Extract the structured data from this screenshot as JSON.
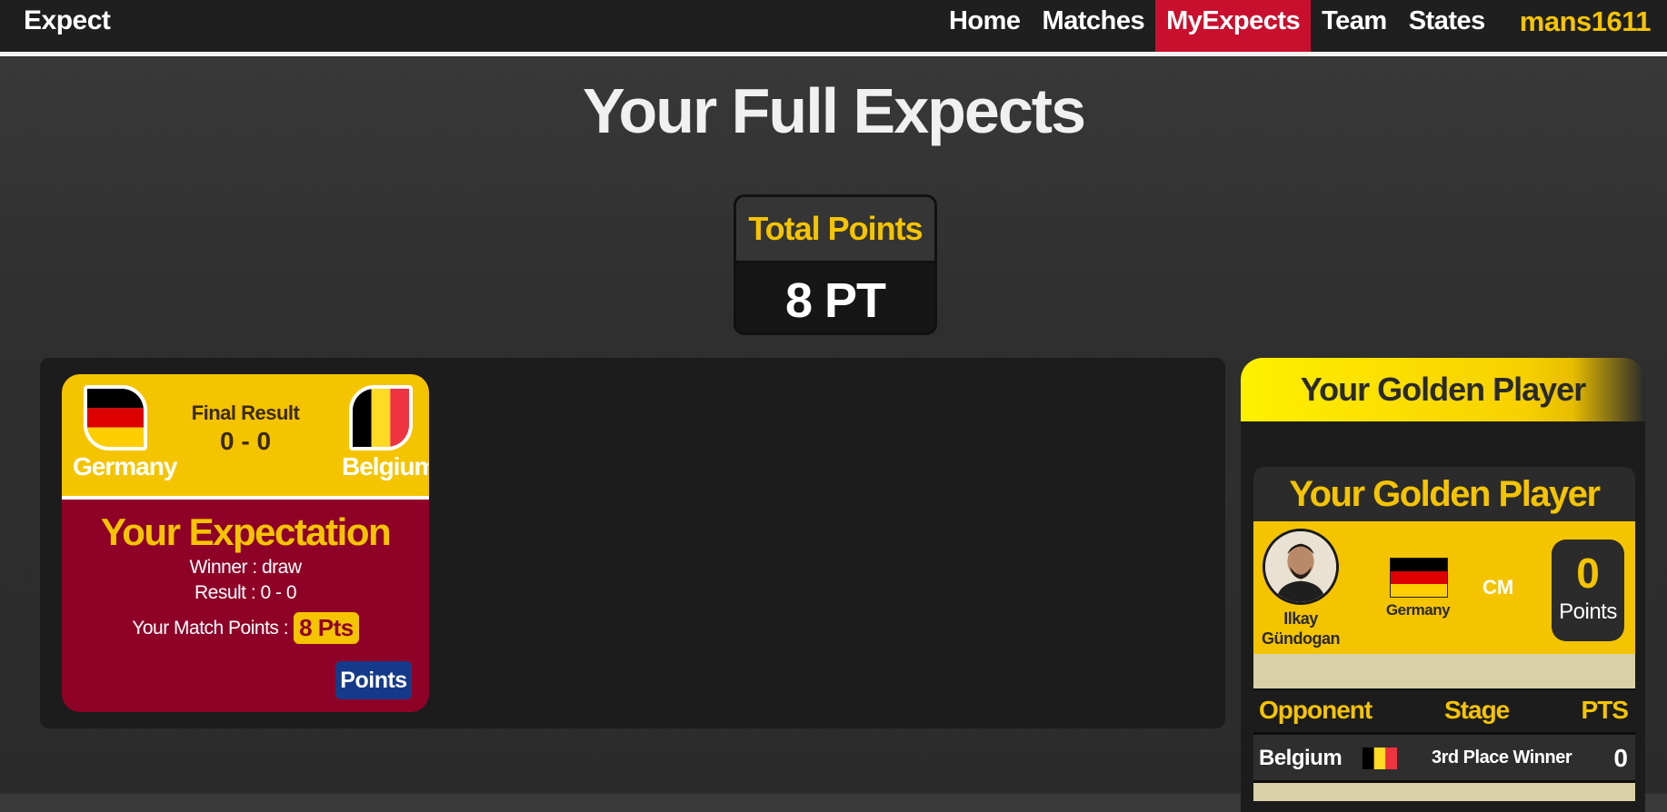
{
  "navbar": {
    "brand": "Expect",
    "links": [
      "Home",
      "Matches",
      "MyExpects",
      "Team",
      "States"
    ],
    "active": "MyExpects",
    "user": "mans1611"
  },
  "page_title": "Your Full Expects",
  "total": {
    "label": "Total Points",
    "value": "8 PT"
  },
  "match": {
    "home_team": "Germany",
    "away_team": "Belgium",
    "final_label": "Final Result",
    "final_score": "0 - 0",
    "expectation_title": "Your Expectation",
    "winner_line": "Winner : draw",
    "result_line": "Result : 0 - 0",
    "match_points_label": "Your Match Points :",
    "match_points_value": "8 Pts",
    "points_button": "Points"
  },
  "golden": {
    "panel_title": "Your Golden Player",
    "card_title": "Your Golden Player",
    "player_name_line1": "Ilkay",
    "player_name_line2": "Gündogan",
    "country": "Germany",
    "position": "CM",
    "points_value": "0",
    "points_label": "Points",
    "table": {
      "headers": [
        "Opponent",
        "Stage",
        "PTS"
      ],
      "rows": [
        {
          "opponent": "Belgium",
          "stage": "3rd Place Winner",
          "pts": "0"
        }
      ]
    }
  },
  "colors": {
    "accent_yellow": "#f5c400",
    "accent_red": "#c8102e",
    "card_maroon": "#8f0227",
    "button_blue": "#163a8a"
  }
}
